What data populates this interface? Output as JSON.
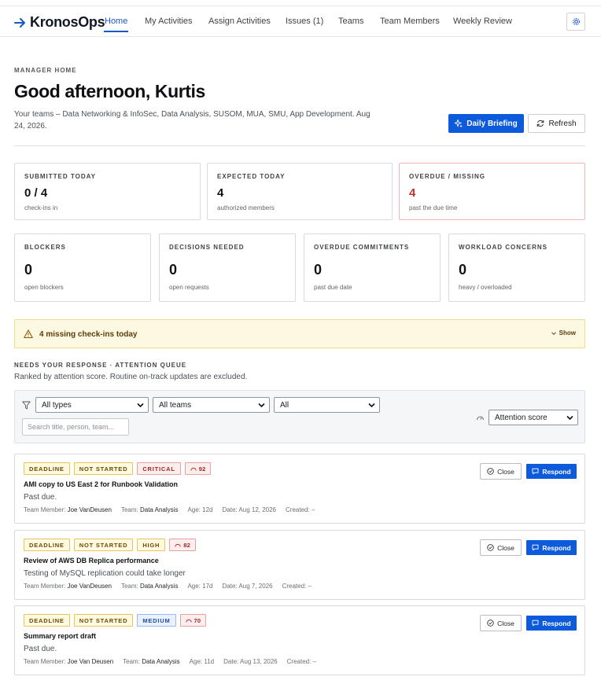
{
  "app": {
    "name": "KronosOps",
    "brand_color": "#1a56c6"
  },
  "nav": {
    "items": [
      {
        "label": "Home",
        "active": true
      },
      {
        "label": "My Activities"
      },
      {
        "label": "Assign Activities"
      },
      {
        "label": "Issues (1)"
      },
      {
        "label": "Teams"
      },
      {
        "label": "Team Members"
      },
      {
        "label": "Weekly Review"
      }
    ],
    "settings_icon": "gear-icon"
  },
  "header": {
    "eyebrow": "MANAGER HOME",
    "greeting": "Good afternoon, Kurtis",
    "teams_line": "Your teams – Data Networking & InfoSec, Data Analysis, SUSOM, MUA, SMU, App Development. Aug 24, 2026.",
    "daily_briefing_label": "Daily Briefing",
    "refresh_label": "Refresh"
  },
  "stats_top": [
    {
      "label": "SUBMITTED TODAY",
      "value": "0 / 4",
      "sub": "check-ins in"
    },
    {
      "label": "EXPECTED TODAY",
      "value": "4",
      "sub": "authorized members"
    },
    {
      "label": "OVERDUE / MISSING",
      "value": "4",
      "sub": "past the due time",
      "status_color": "#c0312b"
    }
  ],
  "stats_bottom": [
    {
      "label": "BLOCKERS",
      "value": "0",
      "sub": "open blockers"
    },
    {
      "label": "DECISIONS NEEDED",
      "value": "0",
      "sub": "open requests"
    },
    {
      "label": "OVERDUE COMMITMENTS",
      "value": "0",
      "sub": "past due date"
    },
    {
      "label": "WORKLOAD CONCERNS",
      "value": "0",
      "sub": "heavy / overloaded"
    }
  ],
  "alert": {
    "text": "4 missing check-ins today",
    "toggle_label": "Show"
  },
  "queue": {
    "title": "NEEDS YOUR RESPONSE · ATTENTION QUEUE",
    "subtitle": "Ranked by attention score. Routine on-track updates are excluded.",
    "filters": {
      "type": "All types",
      "team": "All teams",
      "status": "All",
      "search_placeholder": "Search title, person, team...",
      "sort": "Attention score"
    },
    "items": [
      {
        "tags": [
          "DEADLINE",
          "NOT STARTED",
          "CRITICAL"
        ],
        "score": "92",
        "title": "AMI copy to US East 2 for Runbook Validation",
        "description": "Past due.",
        "member": "Joe VanDeusen",
        "team": "Data Analysis",
        "age": "12d",
        "date": "Aug 12, 2026",
        "created": "–"
      },
      {
        "tags": [
          "DEADLINE",
          "NOT STARTED",
          "HIGH"
        ],
        "score": "82",
        "title": "Review of AWS DB Replica performance",
        "description": "Testing of MySQL replication could take longer",
        "member": "Joe VanDeusen",
        "team": "Data Analysis",
        "age": "17d",
        "date": "Aug 7, 2026",
        "created": "–"
      },
      {
        "tags": [
          "DEADLINE",
          "NOT STARTED",
          "MEDIUM"
        ],
        "score": "70",
        "title": "Summary report draft",
        "description": "Past due.",
        "member": "Joe Van Deusen",
        "team": "Data Analysis",
        "age": "11d",
        "date": "Aug 13, 2026",
        "created": "–"
      }
    ],
    "labels": {
      "member": "Team Member:",
      "team": "Team:",
      "age": "Age:",
      "date": "Date:",
      "created": "Created:",
      "close": "Close",
      "respond": "Respond"
    }
  }
}
